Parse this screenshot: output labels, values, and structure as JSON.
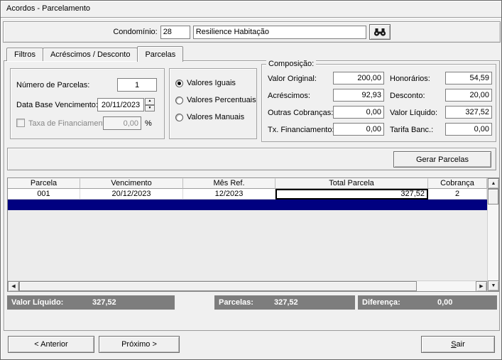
{
  "window": {
    "title": "Acordos - Parcelamento"
  },
  "header": {
    "condominio_label": "Condomínio:",
    "condominio_code": "28",
    "condominio_name": "Resilience Habitação"
  },
  "tabs": [
    {
      "label": "Filtros"
    },
    {
      "label": "Acréscimos / Desconto"
    },
    {
      "label": "Parcelas"
    }
  ],
  "parcelas_form": {
    "numero_parcelas_label": "Número de Parcelas:",
    "numero_parcelas_value": "1",
    "data_base_label": "Data Base Vencimento:",
    "data_base_value": "20/11/2023",
    "taxa_financiamento_label": "Taxa de Financiamento",
    "taxa_financiamento_value": "0,00",
    "percent_suffix": "%"
  },
  "valores_modo": [
    {
      "label": "Valores Iguais",
      "selected": true
    },
    {
      "label": "Valores Percentuais",
      "selected": false
    },
    {
      "label": "Valores Manuais",
      "selected": false
    }
  ],
  "composicao": {
    "title": "Composição:",
    "col1": [
      {
        "label": "Valor Original:",
        "value": "200,00"
      },
      {
        "label": "Acréscimos:",
        "value": "92,93"
      },
      {
        "label": "Outras Cobranças:",
        "value": "0,00"
      },
      {
        "label": "Tx. Financiamento:",
        "value": "0,00"
      }
    ],
    "col2": [
      {
        "label": "Honorários:",
        "value": "54,59"
      },
      {
        "label": "Desconto:",
        "value": "20,00"
      },
      {
        "label": "Valor Líquido:",
        "value": "327,52"
      },
      {
        "label": "Tarifa Banc.:",
        "value": "0,00"
      }
    ]
  },
  "buttons": {
    "gerar_parcelas": "Gerar Parcelas",
    "anterior": "< Anterior",
    "proximo": "Próximo >",
    "sair": "Sair"
  },
  "grid": {
    "columns": [
      "Parcela",
      "Vencimento",
      "Mês Ref.",
      "Total Parcela",
      "Cobrança"
    ],
    "rows": [
      {
        "parcela": "001",
        "vencimento": "20/12/2023",
        "mes_ref": "12/2023",
        "total": "327,52",
        "cobranca": "2"
      }
    ]
  },
  "totais": [
    {
      "label": "Valor Líquido:",
      "value": "327,52"
    },
    {
      "label": "Parcelas:",
      "value": "327,52"
    },
    {
      "label": "Diferença:",
      "value": "0,00"
    }
  ],
  "icons": {
    "search": "binoculars",
    "spin_up": "▲",
    "spin_down": "▼",
    "scroll_up": "▲",
    "scroll_down": "▼",
    "scroll_left": "◀",
    "scroll_right": "▶"
  }
}
